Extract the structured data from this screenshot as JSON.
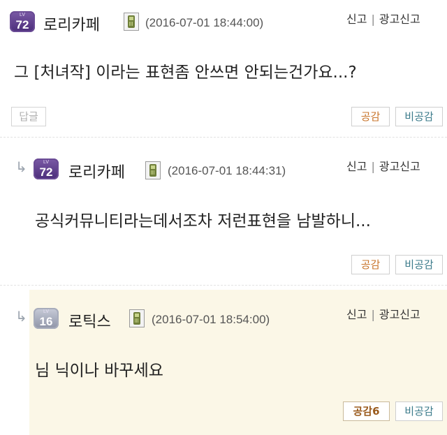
{
  "comments": [
    {
      "level": "72",
      "level_prefix": "LV",
      "nickname": "로리카페",
      "date": "(2016-07-01 18:44:00)",
      "report": "신고",
      "sep": "|",
      "ad_report": "광고신고",
      "content": "그 [처녀작] 이라는 표현좀 안쓰면 안되는건가요...?",
      "reply_btn": "답글",
      "like_btn": "공감",
      "dislike_btn": "비공감"
    },
    {
      "reply_arrow": "↳",
      "level": "72",
      "level_prefix": "LV",
      "nickname": "로리카페",
      "date": "(2016-07-01 18:44:31)",
      "report": "신고",
      "sep": "|",
      "ad_report": "광고신고",
      "content": "공식커뮤니티라는데서조차 저런표현을 남발하니...",
      "like_btn": "공감",
      "dislike_btn": "비공감"
    },
    {
      "reply_arrow": "↳",
      "level": "16",
      "level_prefix": "LV",
      "nickname": "로틱스",
      "date": "(2016-07-01 18:54:00)",
      "report": "신고",
      "sep": "|",
      "ad_report": "광고신고",
      "content": "님 닉이나 바꾸세요",
      "like_btn": "공감6",
      "dislike_btn": "비공감"
    }
  ],
  "colors": {
    "level_badge_purple": "#5a3a8a",
    "level_badge_gray": "#9aa0b2",
    "like_text": "#c8742b",
    "dislike_text": "#3a7a8a",
    "highlight_bg": "#fbf7e7"
  },
  "icons": {
    "mobile": "mobile-phone-icon",
    "reply_arrow": "reply-arrow-icon"
  }
}
